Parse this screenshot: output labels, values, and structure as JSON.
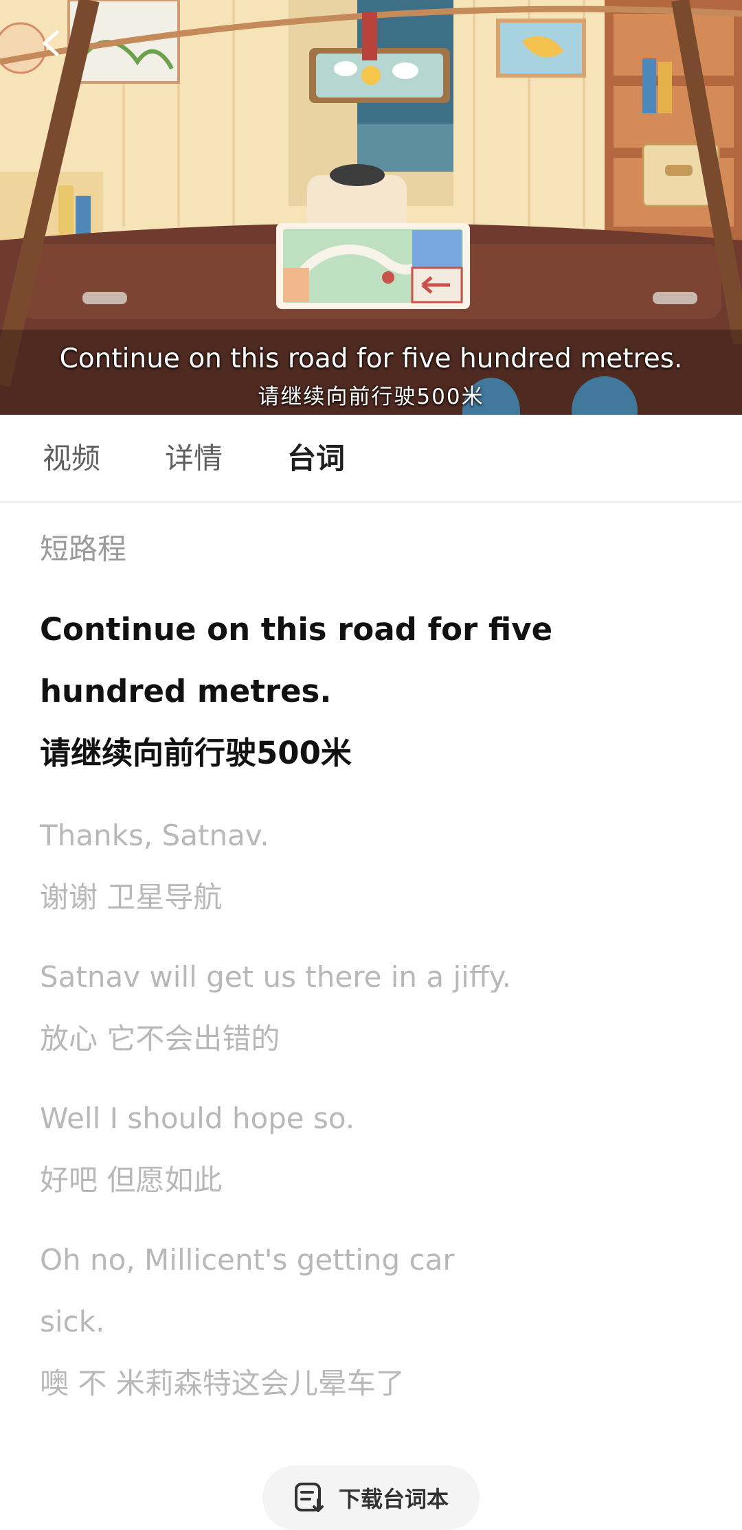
{
  "video": {
    "subtitle_en": "Continue on this road for five hundred metres.",
    "subtitle_zh": "请继续向前行驶500米"
  },
  "tabs": [
    {
      "label": "视频"
    },
    {
      "label": "详情"
    },
    {
      "label": "台词",
      "active": true
    }
  ],
  "script": {
    "section_title": "短路程",
    "lines": [
      {
        "en_lines": [
          "Continue on this road for five",
          "hundred metres."
        ],
        "zh": "请继续向前行驶500米",
        "active": true
      },
      {
        "en_lines": [
          "Thanks, Satnav."
        ],
        "zh": "谢谢 卫星导航"
      },
      {
        "en_lines": [
          "Satnav will get us there in a jiffy."
        ],
        "zh": "放心 它不会出错的"
      },
      {
        "en_lines": [
          "Well I should hope so."
        ],
        "zh": "好吧 但愿如此"
      },
      {
        "en_lines": [
          "Oh no, Millicent's getting car",
          "sick."
        ],
        "zh": "噢 不 米莉森特这会儿晕车了"
      }
    ]
  },
  "download": {
    "label": "下载台词本",
    "icon": "script-download-icon"
  },
  "colors": {
    "active_text": "#111111",
    "inactive_text": "#b8b8b8",
    "tab_inactive": "#5f5f5f"
  }
}
